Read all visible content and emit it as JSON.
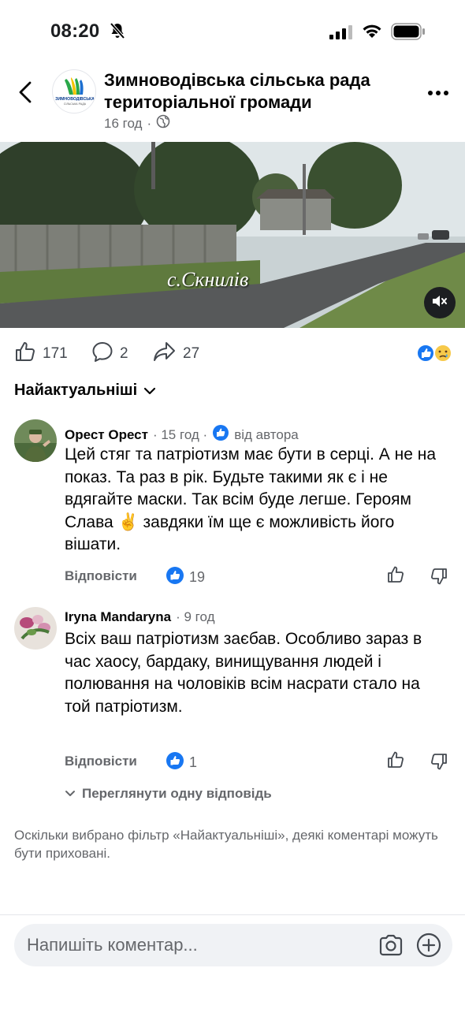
{
  "status_bar": {
    "time": "08:20"
  },
  "header": {
    "page_name": "Зимноводівська сільська рада територіальної громади",
    "time_ago": "16 год",
    "separator": "·",
    "logo_text": "ЗИМНОВОДІВСЬКА",
    "logo_subtext": "СІЛЬСЬКА РАДА"
  },
  "video": {
    "caption": "с.Скнилів"
  },
  "actions": {
    "likes": "171",
    "comments": "2",
    "shares": "27"
  },
  "sort": {
    "label": "Найактуальніші"
  },
  "comments": [
    {
      "author": "Орест Орест",
      "time": "· 15 год ·",
      "badge": "від автора",
      "text": "Цей стяг та патріотизм має бути в серці. А не на показ. Та раз в рік. Будьте такими як є і не вдягайте маски. Так всім буде легше. Героям Слава ✌️ завдяки їм ще є можливість його вішати.",
      "reply_label": "Відповісти",
      "like_count": "19"
    },
    {
      "author": "Iryna Mandaryna",
      "time": "· 9 год",
      "text": "Всіх ваш патріотизм заєбав. Особливо зараз в час хаосу, бардаку, винищування людей і полювання на чоловіків всім насрати стало на той патріотизм.",
      "reply_label": "Відповісти",
      "like_count": "1"
    }
  ],
  "view_replies": "Переглянути одну відповідь",
  "filter_note": "Оскільки вибрано фільтр «Найактуальніші», деякі коментарі можуть бути приховані.",
  "composer": {
    "placeholder": "Напишіть коментар..."
  },
  "colors": {
    "facebook_blue": "#1877f2",
    "secondary_text": "#65676b"
  }
}
